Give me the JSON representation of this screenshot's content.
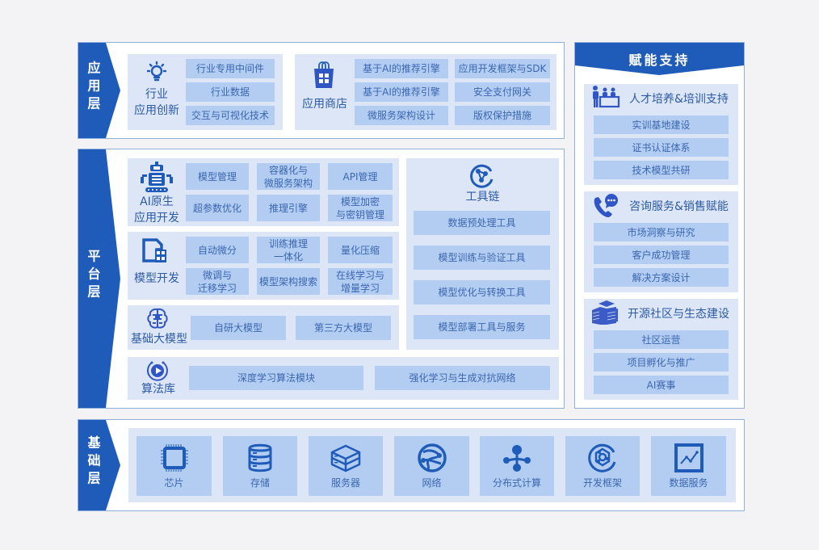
{
  "colors": {
    "primary": "#1f5bb8",
    "panel": "#dde6f7",
    "cell": "#b3cdf2",
    "text": "#3a66b0",
    "border": "#8fb0dc"
  },
  "app_layer": {
    "tag": "应用层",
    "industry": {
      "title_line1": "行业",
      "title_line2": "应用创新",
      "icon": "lightbulb-icon",
      "items": [
        "行业专用中间件",
        "行业数据",
        "交互与可视化技术"
      ]
    },
    "store": {
      "title": "应用商店",
      "icon": "shopping-bag-icon",
      "items": [
        "基于AI的推荐引擎",
        "应用开发框架与SDK",
        "基于AI的推荐引擎",
        "安全支付网关",
        "微服务架构设计",
        "版权保护措施"
      ]
    }
  },
  "platform_layer": {
    "tag": "平台层",
    "ai_native": {
      "title_line1": "AI原生",
      "title_line2": "应用开发",
      "icon": "robot-icon",
      "items": [
        [
          "模型管理"
        ],
        [
          "容器化与",
          "微服务架构"
        ],
        [
          "API管理"
        ],
        [
          "超参数优化"
        ],
        [
          "推理引擎"
        ],
        [
          "模型加密",
          "与密钥管理"
        ]
      ]
    },
    "model_dev": {
      "title": "模型开发",
      "icon": "document-grid-icon",
      "items": [
        [
          "自动微分"
        ],
        [
          "训练推理",
          "一体化"
        ],
        [
          "量化压缩"
        ],
        [
          "微调与",
          "迁移学习"
        ],
        [
          "模型架构搜索"
        ],
        [
          "在线学习与",
          "增量学习"
        ]
      ]
    },
    "foundation": {
      "title": "基础大模型",
      "icon": "brain-icon",
      "items": [
        "自研大模型",
        "第三方大模型"
      ]
    },
    "toolchain": {
      "title": "工具链",
      "icon": "network-nodes-icon",
      "items": [
        "数据预处理工具",
        "模型训练与验证工具",
        "模型优化与转换工具",
        "模型部署工具与服务"
      ]
    },
    "algorithms": {
      "title": "算法库",
      "icon": "ai-play-icon",
      "items": [
        "深度学习算法模块",
        "强化学习与生成对抗网络"
      ]
    }
  },
  "support": {
    "header": "赋能支持",
    "groups": [
      {
        "title": "人才培养&培训支持",
        "icon": "people-training-icon",
        "items": [
          "实训基地建设",
          "证书认证体系",
          "技术模型共研"
        ]
      },
      {
        "title": "咨询服务&销售赋能",
        "icon": "phone-chat-icon",
        "items": [
          "市场洞察与研究",
          "客户成功管理",
          "解决方案设计"
        ]
      },
      {
        "title": "开源社区与生态建设",
        "icon": "buildings-icon",
        "items": [
          "社区运营",
          "项目孵化与推广",
          "AI赛事"
        ]
      }
    ]
  },
  "base_layer": {
    "tag": "基础层",
    "items": [
      {
        "label": "芯片",
        "icon": "chip-icon"
      },
      {
        "label": "存储",
        "icon": "database-icon"
      },
      {
        "label": "服务器",
        "icon": "server-icon"
      },
      {
        "label": "网络",
        "icon": "globe-network-icon"
      },
      {
        "label": "分布式计算",
        "icon": "distributed-nodes-icon"
      },
      {
        "label": "开发框架",
        "icon": "framework-icon"
      },
      {
        "label": "数据服务",
        "icon": "chart-line-icon"
      }
    ]
  }
}
